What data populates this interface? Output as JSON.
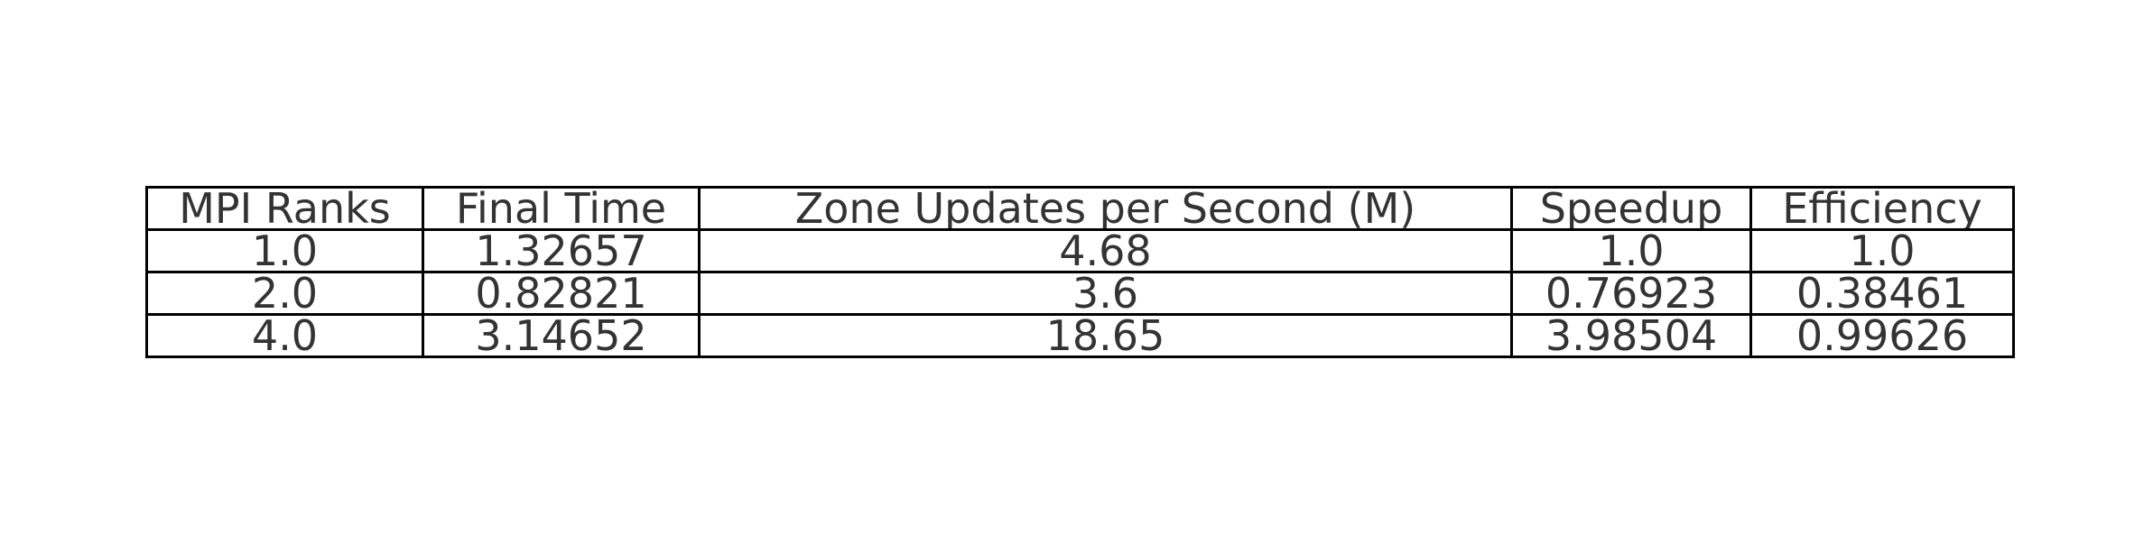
{
  "chart_data": {
    "type": "table",
    "columns": [
      "MPI Ranks",
      "Final Time",
      "Zone Updates per Second (M)",
      "Speedup",
      "Efficiency"
    ],
    "rows": [
      [
        "1.0",
        "1.32657",
        "4.68",
        "1.0",
        "1.0"
      ],
      [
        "2.0",
        "0.82821",
        "3.6",
        "0.76923",
        "0.38461"
      ],
      [
        "4.0",
        "3.14652",
        "18.65",
        "3.98504",
        "0.99626"
      ]
    ]
  },
  "colors": {
    "text": "#333333",
    "border": "#000000",
    "background": "#ffffff"
  }
}
